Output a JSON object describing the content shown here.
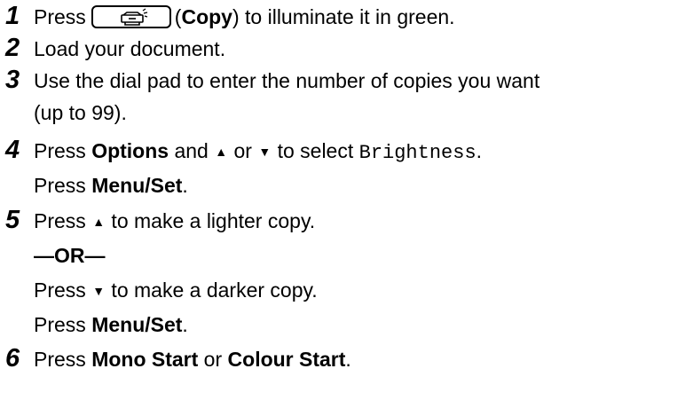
{
  "steps": [
    {
      "number": "1",
      "lines": [
        {
          "pre": "Press",
          "key_icon": "copy-machine-icon",
          "paren_open": "(",
          "bold": "Copy",
          "paren_close": ")",
          "post": " to illuminate it in green."
        }
      ]
    },
    {
      "number": "2",
      "lines": [
        {
          "text": "Load your document."
        }
      ]
    },
    {
      "number": "3",
      "lines": [
        {
          "text": "Use the dial pad to enter the number of copies you want"
        },
        {
          "text": "(up to 99)."
        }
      ]
    },
    {
      "number": "4",
      "lines": [
        {
          "pre": "Press ",
          "bold": "Options",
          "mid1": " and ",
          "up_arrow": "▲",
          "mid2": " or ",
          "down_arrow": "▼",
          "mid3": " to select ",
          "mono": "Brightness",
          "post": "."
        },
        {
          "pre": "Press ",
          "bold": "Menu/Set",
          "post": "."
        }
      ]
    },
    {
      "number": "5",
      "lines": [
        {
          "pre": "Press ",
          "up_arrow": "▲",
          "post": " to make a lighter copy."
        },
        {
          "or": "—OR—"
        },
        {
          "pre": "Press ",
          "down_arrow": "▼",
          "post": " to make a darker copy."
        },
        {
          "pre": "Press ",
          "bold": "Menu/Set",
          "post": "."
        }
      ]
    },
    {
      "number": "6",
      "lines": [
        {
          "pre": "Press ",
          "bold": "Mono Start",
          "mid1": " or ",
          "bold2": "Colour Start",
          "post": "."
        }
      ]
    }
  ]
}
